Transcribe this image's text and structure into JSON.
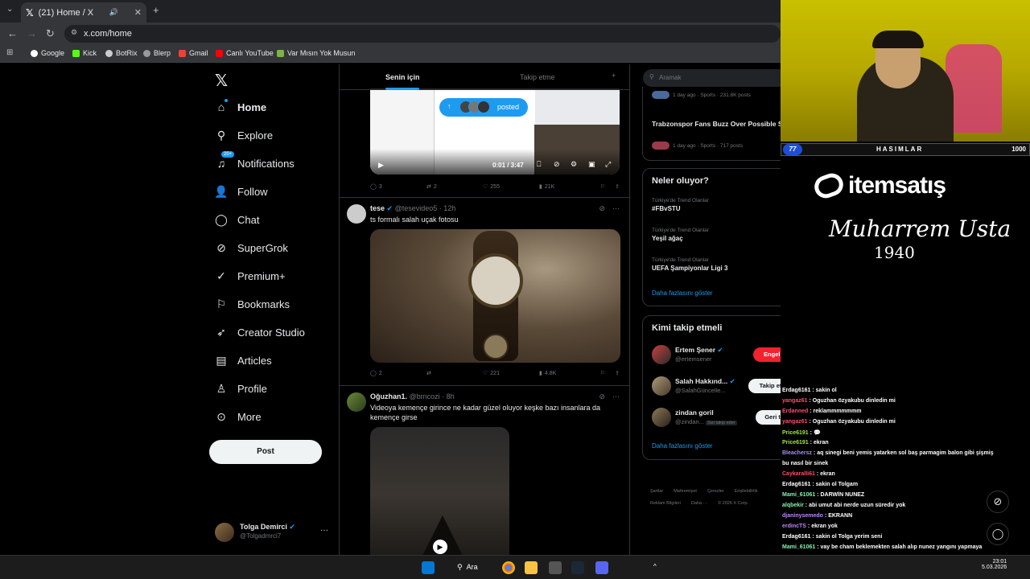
{
  "browser": {
    "tab_title": "(21) Home / X",
    "url": "x.com/home",
    "bookmarks": [
      "Google",
      "Kick",
      "BotRix",
      "Blerp",
      "Gmail",
      "Canlı YouTube",
      "Var Mısın Yok Musun"
    ]
  },
  "nav": {
    "items": [
      {
        "label": "Home",
        "icon": "home-icon"
      },
      {
        "label": "Explore",
        "icon": "search-icon"
      },
      {
        "label": "Notifications",
        "icon": "bell-icon"
      },
      {
        "label": "Follow",
        "icon": "person-add-icon"
      },
      {
        "label": "Chat",
        "icon": "chat-icon"
      },
      {
        "label": "SuperGrok",
        "icon": "grok-icon"
      },
      {
        "label": "Premium+",
        "icon": "verified-icon"
      },
      {
        "label": "Bookmarks",
        "icon": "bookmark-icon"
      },
      {
        "label": "Creator Studio",
        "icon": "rocket-icon"
      },
      {
        "label": "Articles",
        "icon": "article-icon"
      },
      {
        "label": "Profile",
        "icon": "person-icon"
      },
      {
        "label": "More",
        "icon": "more-icon"
      }
    ],
    "notifications_badge": "20+",
    "post_label": "Post",
    "account_name": "Tolga Demirci",
    "account_handle": "@Tolgadmrci7"
  },
  "feed": {
    "tabs": [
      "Senin için",
      "Takip etme"
    ],
    "posted_pill": "posted",
    "video_time": "0:01 / 3:47",
    "tweet1_stats": {
      "replies": "3",
      "reposts": "2",
      "likes": "255",
      "views": "21K"
    },
    "tweet2": {
      "name": "tese",
      "handle": "@tesevideo5",
      "time": "· 12h",
      "text": "ts formalı salah uçak fotosu",
      "stats": {
        "replies": "2",
        "reposts": "",
        "likes": "221",
        "views": "4.8K"
      }
    },
    "tweet3": {
      "name": "Oğuzhan1.",
      "handle": "@brncozi",
      "time": "· 8h",
      "text": "Videoya kemençe girince ne kadar güzel oluyor keşke bazı insanlara da kemençe girse"
    }
  },
  "right": {
    "search_placeholder": "Aramak",
    "trend_top_meta1": "1 day ago · Sports · 231.8K posts",
    "trend_top_title": "Trabzonspor Fans Buzz Over Possible Signing",
    "trend_top_meta2": "1 day ago · Sports · 717 posts",
    "whats_happening": "Neler oluyor?",
    "trends": [
      {
        "meta": "Türkiye'de Trend Olanlar",
        "title": "#FBvSTU"
      },
      {
        "meta": "Türkiye'de Trend Olanlar",
        "title": "Yeşil ağaç"
      },
      {
        "meta": "Türkiye'de Trend Olanlar",
        "title": "UEFA Şampiyonlar Ligi 3"
      }
    ],
    "show_more": "Daha fazlasını göster",
    "who_to_follow": "Kimi takip etmeli",
    "follows": [
      {
        "name": "Ertem Şener",
        "handle": "@ertemsener",
        "button": "Engellendi"
      },
      {
        "name": "Salah Hakkınd...",
        "handle": "@SalahGüncelle...",
        "button": "Takip etmek"
      },
      {
        "name": "zindan goril",
        "handle": "@zindan...",
        "note": "Sizi takip eder",
        "button": "Geri takip et"
      }
    ],
    "footer_line1": [
      "Şartlar",
      "Mahremiyet",
      "Çerezler",
      "Erişilebilirlik"
    ],
    "footer_line2": [
      "Reklam Bilgileri",
      "Daha ···",
      "© 2026 X Corp."
    ]
  },
  "stream": {
    "team_name": "HASIMLAR",
    "level": "77",
    "score": "1000",
    "sponsor": "itemsatış",
    "signature": "Muharrem Usta",
    "signature_year": "1940",
    "chat": [
      {
        "user": "Erdag6161",
        "msg": "sakin ol",
        "color": "#ffffff"
      },
      {
        "user": "yangaz61",
        "msg": "Oguzhan özyakubu dinledin mi",
        "color": "#ff4d6d"
      },
      {
        "user": "Erdanned",
        "msg": "reklammmmmmm",
        "color": "#ff4d6d"
      },
      {
        "user": "yangaz61",
        "msg": "Oguzhan özyakubu dinledin mi",
        "color": "#ff4d6d"
      },
      {
        "user": "Price6191",
        "msg": "💬",
        "color": "#a3e635"
      },
      {
        "user": "Price6191",
        "msg": "ekran",
        "color": "#a3e635"
      },
      {
        "user": "Bleachersz",
        "msg": "aq sinegi beni yemis yatarken sol baş parmagim balon gibi şişmiş",
        "color": "#a78bfa"
      },
      {
        "user": "",
        "msg": "bu nasıl bir sinek",
        "color": "#ffffff"
      },
      {
        "user": "Caykaralli61",
        "msg": "ekran",
        "color": "#ff4d6d"
      },
      {
        "user": "Erdag6161",
        "msg": "sakin ol Tolgam",
        "color": "#ffffff"
      },
      {
        "user": "Mami_61061",
        "msg": "DARWİN NUNEZ",
        "color": "#86efac"
      },
      {
        "user": "alqbekir",
        "msg": "abi umut abi nerde uzun süredir yok",
        "color": "#86efac"
      },
      {
        "user": "djaninysemedo",
        "msg": "EKRANN",
        "color": "#c084fc"
      },
      {
        "user": "erdincTS",
        "msg": "ekran yok",
        "color": "#c084fc"
      },
      {
        "user": "Erdag6161",
        "msg": "sakin ol Tolga yerim seni",
        "color": "#ffffff"
      },
      {
        "user": "Mami_61061",
        "msg": "vay be cham beklemekten salah alıp nunez yangını yapmaya",
        "color": "#86efac"
      }
    ]
  },
  "taskbar": {
    "search_label": "Ara",
    "time": "23:01",
    "date": "5.03.2026"
  }
}
